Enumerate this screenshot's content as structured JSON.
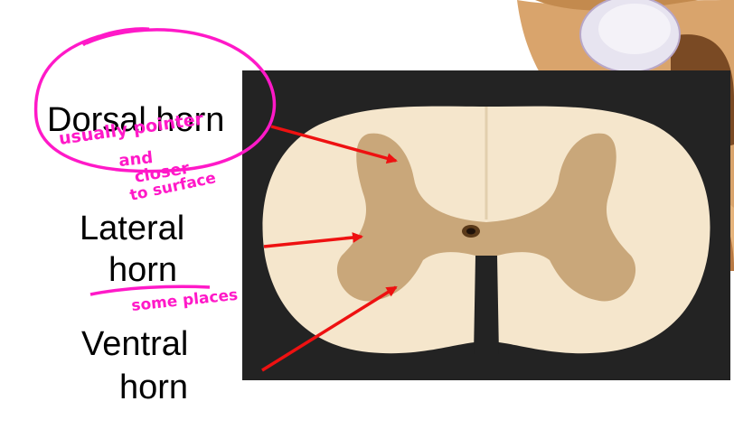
{
  "labels": {
    "dorsal": "Dorsal horn",
    "lateral_line1": "Lateral",
    "lateral_line2": "horn",
    "ventral_line1": "Ventral",
    "ventral_line2": "horn"
  },
  "annotations": {
    "note1": "usually pointer",
    "note2": "and",
    "note3": "closer",
    "note4": "to surface",
    "note5": "some places"
  },
  "colors": {
    "annotation_ink": "#ff19c8",
    "arrow": "#ee1111",
    "white_matter": "#f5e6cc",
    "gray_matter": "#c9a77a",
    "background_panel": "#232323"
  }
}
